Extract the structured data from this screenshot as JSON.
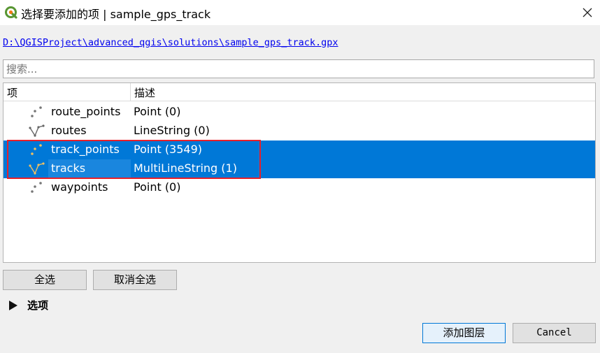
{
  "window": {
    "title": "选择要添加的项 | sample_gps_track",
    "close_icon": "close-icon",
    "app_icon": "qgis-logo-icon"
  },
  "source_path": "D:\\QGISProject\\advanced_qgis\\solutions\\sample_gps_track.gpx",
  "search": {
    "placeholder": "搜索..."
  },
  "table": {
    "headers": {
      "item": "项",
      "description": "描述"
    },
    "rows": [
      {
        "name": "route_points",
        "description": "Point (0)",
        "icon": "point-layer-icon",
        "selected": false
      },
      {
        "name": "routes",
        "description": "LineString (0)",
        "icon": "line-layer-icon",
        "selected": false
      },
      {
        "name": "track_points",
        "description": "Point (3549)",
        "icon": "point-layer-icon",
        "selected": true
      },
      {
        "name": "tracks",
        "description": "MultiLineString (1)",
        "icon": "line-layer-icon",
        "selected": true
      },
      {
        "name": "waypoints",
        "description": "Point (0)",
        "icon": "point-layer-icon",
        "selected": false
      }
    ]
  },
  "buttons": {
    "select_all": "全选",
    "deselect_all": "取消全选",
    "add_layers": "添加图层",
    "cancel": "Cancel"
  },
  "options": {
    "label": "选项",
    "icon": "expand-arrow-icon"
  },
  "colors": {
    "selection": "#0078d7",
    "annotation": "#e8202a",
    "link": "#0000ee",
    "qgis_green": "#589632",
    "qgis_yellow": "#ee7913"
  }
}
